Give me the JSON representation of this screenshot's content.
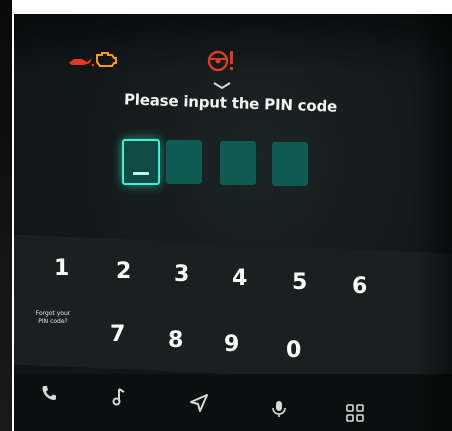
{
  "indicators": {
    "oil_pressure": "oil-pressure-warning-icon",
    "engine": "check-engine-warning-icon",
    "steering": "steering-warning-icon",
    "warning_color": "#e03a25"
  },
  "pin_dialog": {
    "prompt": "Please input the PIN code",
    "digits_total": 4,
    "digits_entered": 0,
    "accent_color": "#3ef0d4",
    "box_color": "#0f5a51"
  },
  "keypad": {
    "row1": [
      "1",
      "2",
      "3",
      "4",
      "5",
      "6"
    ],
    "row2": [
      "7",
      "8",
      "9",
      "0"
    ],
    "forgot_label": "Forgot your PIN code?"
  },
  "bottom_nav": {
    "items": [
      "phone-icon",
      "music-icon",
      "navigation-icon",
      "microphone-icon",
      "apps-grid-icon"
    ]
  }
}
